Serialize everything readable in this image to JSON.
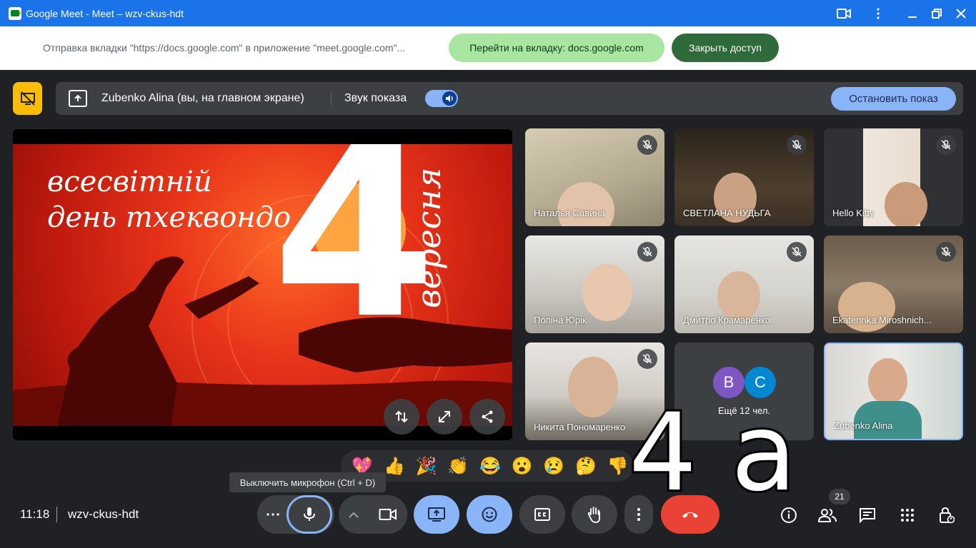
{
  "window": {
    "title": "Google Meet - Meet – wzv-ckus-hdt"
  },
  "share_notice": {
    "message": "Отправка вкладки \"https://docs.google.com\" в приложение \"meet.google.com\"...",
    "goto_label": "Перейти на вкладку: docs.google.com",
    "stop_label": "Закрыть доступ"
  },
  "present_bar": {
    "presenter": "Zubenko Alina (вы, на главном экране)",
    "sound_label": "Звук показа",
    "sound_on": true,
    "stop_label": "Остановить показ"
  },
  "slide": {
    "line1": "всесвітній",
    "line2": "день тхеквондо",
    "big_number": "4",
    "vertical": "вересня"
  },
  "participants": [
    {
      "name": "Наталья Савина",
      "muted": true
    },
    {
      "name": "СВЕТЛАНА НУДЬГА",
      "muted": true
    },
    {
      "name": "Hello Kitty",
      "muted": true
    },
    {
      "name": "Поліна Юрік",
      "muted": true
    },
    {
      "name": "Дмитро Крамаренко",
      "muted": true
    },
    {
      "name": "Ekaterinka Miroshnich...",
      "muted": true
    },
    {
      "name": "Никита Пономаренко",
      "muted": true
    }
  ],
  "more_tile": {
    "avatars": [
      "B",
      "C"
    ],
    "avatar_colors": [
      "#7e57c2",
      "#0288d1"
    ],
    "label": "Ещё 12 чел."
  },
  "self_tile": {
    "name": "Zubenko Alina"
  },
  "overlay_text": "4 a",
  "reactions": [
    "💖",
    "👍",
    "🎉",
    "👏",
    "😂",
    "😮",
    "😢",
    "🤔",
    "👎"
  ],
  "tooltip": "Выключить микрофон (Ctrl + D)",
  "bottom": {
    "time": "11:18",
    "meeting_code": "wzv-ckus-hdt",
    "people_count": "21"
  },
  "colors": {
    "titlebar": "#1a73e8",
    "accent": "#8ab4f8",
    "end_call": "#ea4335",
    "present_warn": "#fbbc04"
  }
}
